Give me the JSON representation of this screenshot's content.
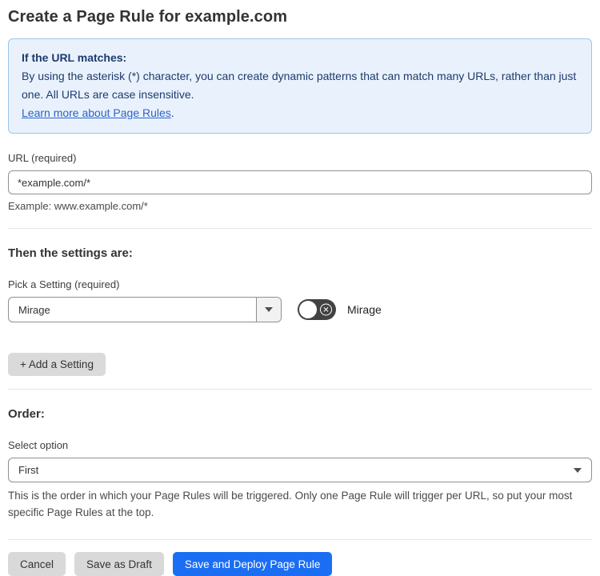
{
  "page": {
    "title": "Create a Page Rule for example.com"
  },
  "info_box": {
    "heading": "If the URL matches:",
    "body": "By using the asterisk (*) character, you can create dynamic patterns that can match many URLs, rather than just one. All URLs are case insensitive.",
    "link_label": "Learn more about Page Rules",
    "link_suffix": "."
  },
  "url_field": {
    "label": "URL (required)",
    "value": "*example.com/*",
    "example": "Example: www.example.com/*"
  },
  "settings_section": {
    "heading": "Then the settings are:",
    "pick_label": "Pick a Setting (required)",
    "setting_select": {
      "selected": "Mirage"
    },
    "toggle": {
      "state": "off",
      "label": "Mirage",
      "icon": "x-circle-icon"
    },
    "add_button_label": "+ Add a Setting"
  },
  "order_section": {
    "heading": "Order:",
    "label": "Select option",
    "order_select": {
      "selected": "First"
    },
    "help": "This is the order in which your Page Rules will be triggered. Only one Page Rule will trigger per URL, so put your most specific Page Rules at the top."
  },
  "footer": {
    "cancel_label": "Cancel",
    "save_draft_label": "Save as Draft",
    "save_deploy_label": "Save and Deploy Page Rule"
  },
  "colors": {
    "primary_blue": "#1b6ef3",
    "info_bg": "#e9f2fc",
    "info_border": "#9cc5ea",
    "info_text": "#1e3a6e",
    "link_blue": "#2d63c8",
    "toggle_bg": "#424242",
    "button_gray": "#d9d9d9"
  }
}
